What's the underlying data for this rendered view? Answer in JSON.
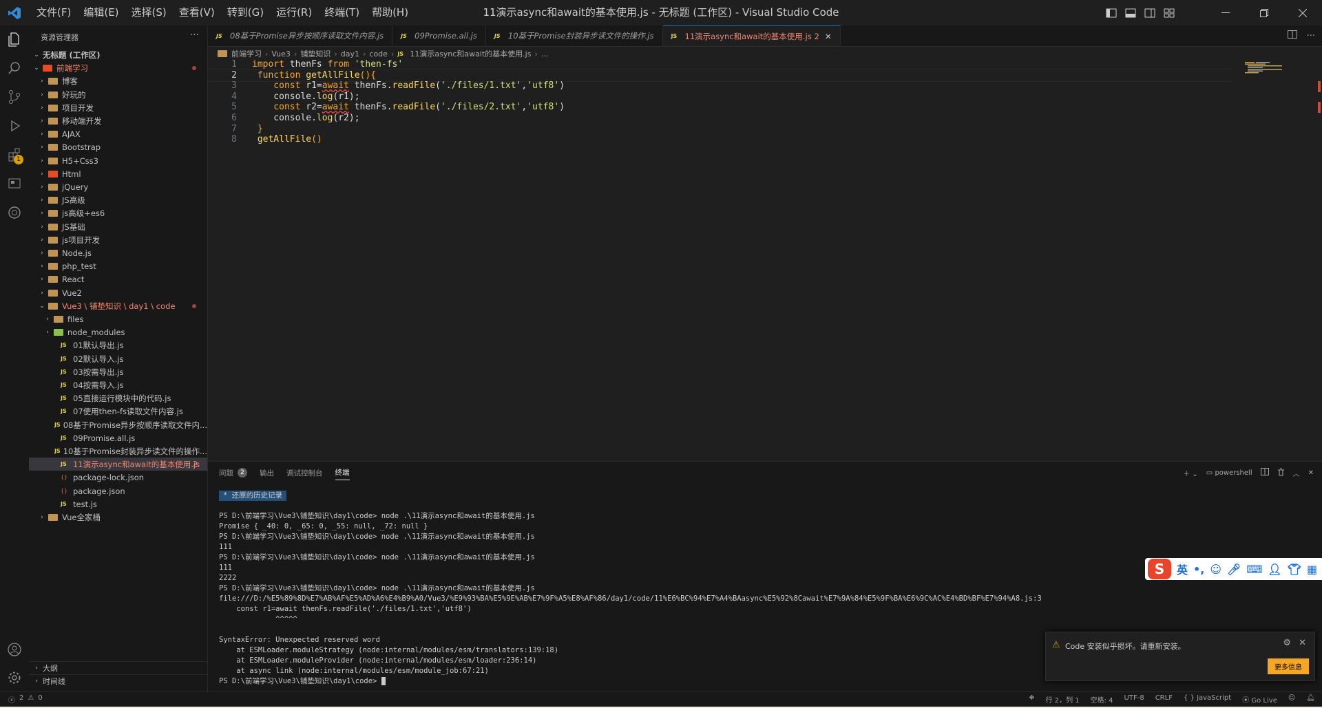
{
  "titlebar": {
    "menus": [
      "文件(F)",
      "编辑(E)",
      "选择(S)",
      "查看(V)",
      "转到(G)",
      "运行(R)",
      "终端(T)",
      "帮助(H)"
    ],
    "title": "11演示async和await的基本使用.js - 无标题 (工作区) - Visual Studio Code"
  },
  "activitybar": {
    "extensions_badge": "1"
  },
  "sidebar": {
    "header": "资源管理器",
    "more": "···",
    "workspace": "无标题 (工作区)",
    "root": "前端学习",
    "folders": [
      "博客",
      "好玩的",
      "项目开发",
      "移动端开发",
      "AJAX",
      "Bootstrap",
      "H5+Css3",
      "Html",
      "jQuery",
      "JS高级",
      "js高级+es6",
      "JS基础",
      "js项目开发",
      "Node.js",
      "php_test",
      "React",
      "Vue2"
    ],
    "open_folder": "Vue3 \\ 铺垫知识 \\ day1 \\ code",
    "sub_folders": [
      "files",
      "node_modules"
    ],
    "files": [
      {
        "name": "01默认导出.js",
        "type": "js"
      },
      {
        "name": "02默认导入.js",
        "type": "js"
      },
      {
        "name": "03按需导出.js",
        "type": "js"
      },
      {
        "name": "04按需导入.js",
        "type": "js"
      },
      {
        "name": "05直接运行模块中的代码.js",
        "type": "js"
      },
      {
        "name": "07使用then-fs读取文件内容.js",
        "type": "js"
      },
      {
        "name": "08基于Promise异步按顺序读取文件内...",
        "type": "js"
      },
      {
        "name": "09Promise.all.js",
        "type": "js"
      },
      {
        "name": "10基于Promise封装异步读文件的操作...",
        "type": "js"
      },
      {
        "name": "11演示async和await的基本使用.js",
        "type": "js",
        "errors": "2"
      },
      {
        "name": "package-lock.json",
        "type": "json"
      },
      {
        "name": "package.json",
        "type": "json"
      },
      {
        "name": "test.js",
        "type": "js"
      }
    ],
    "after": "Vue全家桶",
    "outline": "大纲",
    "timeline": "时间线"
  },
  "tabs": [
    {
      "label": "08基于Promise异步按顺序读取文件内容.js",
      "active": false
    },
    {
      "label": "09Promise.all.js",
      "active": false
    },
    {
      "label": "10基于Promise封装异步读文件的操作.js",
      "active": false
    },
    {
      "label": "11演示async和await的基本使用.js",
      "active": true,
      "badge": "2"
    }
  ],
  "breadcrumb": [
    "前端学习",
    "Vue3",
    "铺垫知识",
    "day1",
    "code",
    "11演示async和await的基本使用.js",
    "..."
  ],
  "editor": {
    "lines": [
      {
        "n": "1",
        "parts": [
          [
            "kw",
            "import"
          ],
          [
            "var",
            " thenFs "
          ],
          [
            "kw",
            "from"
          ],
          [
            "str",
            " 'then-fs'"
          ]
        ]
      },
      {
        "n": "2",
        "parts": [
          [
            "kw",
            " function"
          ],
          [
            "fn",
            " getAllFile"
          ],
          [
            "kw",
            "(){"
          ]
        ]
      },
      {
        "n": "3",
        "parts": [
          [
            "kw",
            "    const"
          ],
          [
            "var",
            " r1="
          ],
          [
            "kw",
            "await"
          ],
          [
            "var",
            " thenFs."
          ],
          [
            "fn",
            "readFile"
          ],
          [
            "var",
            "("
          ],
          [
            "str",
            "'./files/1.txt'"
          ],
          [
            "var",
            ","
          ],
          [
            "str",
            "'utf8'"
          ],
          [
            "var",
            ")"
          ]
        ]
      },
      {
        "n": "4",
        "parts": [
          [
            "var",
            "    console."
          ],
          [
            "fn",
            "log"
          ],
          [
            "var",
            "(r1);"
          ]
        ]
      },
      {
        "n": "5",
        "parts": [
          [
            "kw",
            "    const"
          ],
          [
            "var",
            " r2="
          ],
          [
            "kw",
            "await"
          ],
          [
            "var",
            " thenFs."
          ],
          [
            "fn",
            "readFile"
          ],
          [
            "var",
            "("
          ],
          [
            "str",
            "'./files/2.txt'"
          ],
          [
            "var",
            ","
          ],
          [
            "str",
            "'utf8'"
          ],
          [
            "var",
            ")"
          ]
        ]
      },
      {
        "n": "6",
        "parts": [
          [
            "var",
            "    console."
          ],
          [
            "fn",
            "log"
          ],
          [
            "var",
            "(r2);"
          ]
        ]
      },
      {
        "n": "7",
        "parts": [
          [
            "kw",
            " }"
          ]
        ]
      },
      {
        "n": "8",
        "parts": [
          [
            "fn",
            " getAllFile"
          ],
          [
            "kw",
            "()"
          ]
        ]
      }
    ]
  },
  "panel": {
    "tabs": [
      {
        "label": "问题",
        "badge": "2"
      },
      {
        "label": "输出"
      },
      {
        "label": "调试控制台"
      },
      {
        "label": "终端",
        "active": true
      }
    ],
    "shell": "powershell",
    "history_label": "还原的历史记录",
    "terminal_lines": [
      "",
      "PS D:\\前端学习\\Vue3\\铺垫知识\\day1\\code> node .\\11演示async和await的基本使用.js",
      "Promise { _40: 0, _65: 0, _55: null, _72: null }",
      "PS D:\\前端学习\\Vue3\\铺垫知识\\day1\\code> node .\\11演示async和await的基本使用.js",
      "111",
      "PS D:\\前端学习\\Vue3\\铺垫知识\\day1\\code> node .\\11演示async和await的基本使用.js",
      "111",
      "2222",
      "PS D:\\前端学习\\Vue3\\铺垫知识\\day1\\code> node .\\11演示async和await的基本使用.js",
      "file:///D:/%E5%89%8D%E7%AB%AF%E5%AD%A6%E4%B9%A0/Vue3/%E9%93%BA%E5%9E%AB%E7%9F%A5%E8%AF%86/day1/code/11%E6%BC%94%E7%A4%BAasync%E5%92%8Cawait%E7%9A%84%E5%9F%BA%E6%9C%AC%E4%BD%BF%E7%94%A8.js:3",
      "    const r1=await thenFs.readFile('./files/1.txt','utf8')",
      "             ^^^^^",
      "",
      "SyntaxError: Unexpected reserved word",
      "    at ESMLoader.moduleStrategy (node:internal/modules/esm/translators:139:18)",
      "    at ESMLoader.moduleProvider (node:internal/modules/esm/loader:236:14)",
      "    at async link (node:internal/modules/esm/module_job:67:21)",
      "PS D:\\前端学习\\Vue3\\铺垫知识\\day1\\code> "
    ]
  },
  "ime": {
    "logo": "S",
    "lang": "英"
  },
  "toast": {
    "message": "Code 安装似乎损坏。请重新安装。",
    "button": "更多信息"
  },
  "statusbar": {
    "errors": "2",
    "warnings": "0",
    "position": "行 2，列 1",
    "spaces": "空格: 4",
    "encoding": "UTF-8",
    "eol": "CRLF",
    "language": "JavaScript",
    "golive": "Go Live"
  }
}
